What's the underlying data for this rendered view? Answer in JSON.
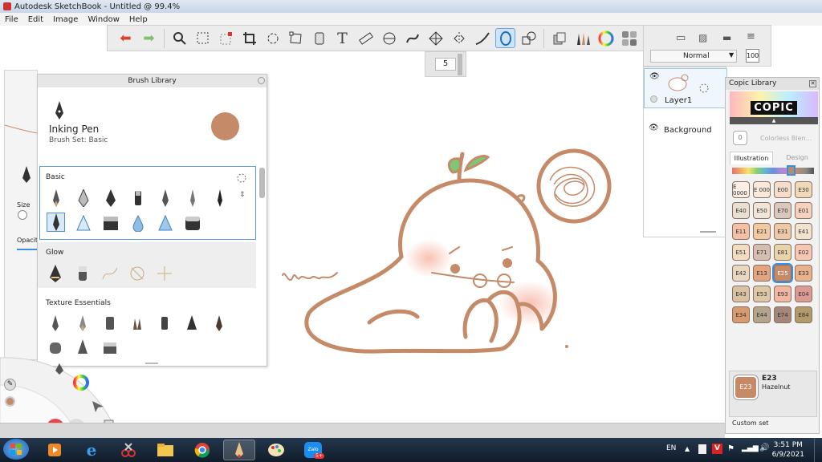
{
  "window": {
    "title": "Autodesk SketchBook - Untitled @ 99.4%"
  },
  "menu": [
    "File",
    "Edit",
    "Image",
    "Window",
    "Help"
  ],
  "toolbar": {
    "brush_size": "5"
  },
  "layers": {
    "blend_mode": "Normal",
    "opacity": "100",
    "items": [
      {
        "name": "Layer1"
      },
      {
        "name": "Background"
      }
    ]
  },
  "brush_library": {
    "title": "Brush Library",
    "current": {
      "name": "Inking Pen",
      "set": "Brush Set: Basic",
      "color": "#c58a67"
    },
    "sets": [
      {
        "label": "Basic"
      },
      {
        "label": "Glow"
      },
      {
        "label": "Texture Essentials"
      }
    ],
    "size_label": "Size",
    "opacity_label": "Opacit"
  },
  "copic": {
    "title": "Copic Library",
    "logo": "COPIC",
    "colorless": "0",
    "colorless_label": "Colorless Blen...",
    "tabs": [
      "Illustration",
      "Design"
    ],
    "swatches": [
      {
        "code": "E 0000",
        "color": "#fbefe6"
      },
      {
        "code": "E 000",
        "color": "#f8e9dc"
      },
      {
        "code": "E00",
        "color": "#f6dcca"
      },
      {
        "code": "E30",
        "color": "#efd9b8"
      },
      {
        "code": "E40",
        "color": "#eadfd3"
      },
      {
        "code": "E50",
        "color": "#f1e5da"
      },
      {
        "code": "E70",
        "color": "#d9c8bd"
      },
      {
        "code": "E01",
        "color": "#f6d1bd"
      },
      {
        "code": "E11",
        "color": "#f2c1a7"
      },
      {
        "code": "E21",
        "color": "#f3c9a4"
      },
      {
        "code": "E31",
        "color": "#edc9a5"
      },
      {
        "code": "E41",
        "color": "#f1e4cf"
      },
      {
        "code": "E51",
        "color": "#f3dcc3"
      },
      {
        "code": "E71",
        "color": "#d5bdb3"
      },
      {
        "code": "E81",
        "color": "#e7d4a9"
      },
      {
        "code": "E02",
        "color": "#f6c8b4"
      },
      {
        "code": "E42",
        "color": "#e9d8c1"
      },
      {
        "code": "E13",
        "color": "#e3a47f"
      },
      {
        "code": "E25",
        "color": "#c58a67"
      },
      {
        "code": "E33",
        "color": "#e8b38c"
      },
      {
        "code": "E43",
        "color": "#d7c3a4"
      },
      {
        "code": "E53",
        "color": "#dcc7a6"
      },
      {
        "code": "E93",
        "color": "#f1b7a2"
      },
      {
        "code": "E04",
        "color": "#dc9a94"
      },
      {
        "code": "E34",
        "color": "#d79b6e"
      },
      {
        "code": "E44",
        "color": "#b2a58c"
      },
      {
        "code": "E74",
        "color": "#a6857a"
      },
      {
        "code": "E84",
        "color": "#b39a6a"
      }
    ],
    "selected": {
      "code": "E23",
      "name": "Hazelnut",
      "color": "#c58a67"
    },
    "custom_set": "Custom set"
  },
  "taskbar": {
    "lang": "EN",
    "time": "3:51 PM",
    "date": "6/9/2021",
    "badge": "5+",
    "zalo": "Zalo"
  },
  "doodle": {
    "signature": "llam"
  }
}
